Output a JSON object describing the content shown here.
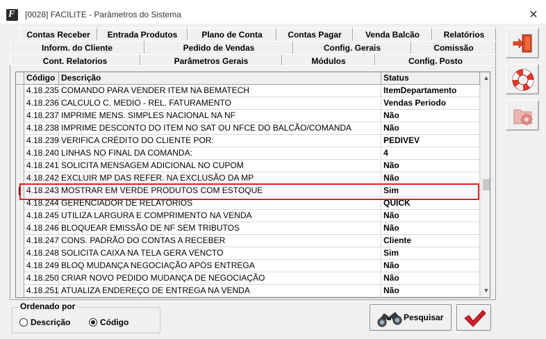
{
  "window": {
    "title": "[0028] FACILITE - Parâmetros do Sistema",
    "close": "✕"
  },
  "tabs": {
    "row1": [
      "Contas Receber",
      "Entrada Produtos",
      "Plano de Conta",
      "Contas Pagar",
      "Venda Balcão",
      "Relatórios"
    ],
    "row2": [
      "Inform. do Cliente",
      "Pedido de Vendas",
      "Config. Gerais",
      "Comissão"
    ],
    "row3": [
      "Cont. Relatorios",
      "Parâmetros Gerais",
      "Módulos",
      "Config. Posto"
    ],
    "active": "Parâmetros Gerais"
  },
  "grid": {
    "columns": [
      "Código",
      "Descrição",
      "Status"
    ],
    "rows": [
      {
        "code": "4.18.235",
        "desc": "COMANDO PARA VENDER ITEM NA BEMATECH",
        "status": "ItemDepartamento"
      },
      {
        "code": "4.18.236",
        "desc": "CALCULO C. MEDIO - REL. FATURAMENTO",
        "status": "Vendas Periodo"
      },
      {
        "code": "4.18.237",
        "desc": "IMPRIME MENS. SIMPLES NACIONAL NA NF",
        "status": "Não"
      },
      {
        "code": "4.18.238",
        "desc": "IMPRIME DESCONTO DO ITEM NO SAT OU NFCE DO BALCÃO/COMANDA",
        "status": "Não"
      },
      {
        "code": "4.18.239",
        "desc": "VERIFICA CRÉDITO DO CLIENTE POR:",
        "status": "PEDIVEV"
      },
      {
        "code": "4.18.240",
        "desc": "LINHAS NO FINAL DA COMANDA:",
        "status": "4"
      },
      {
        "code": "4.18.241",
        "desc": "SOLICITA MENSAGEM ADICIONAL NO CUPOM",
        "status": "Não"
      },
      {
        "code": "4.18.242",
        "desc": "EXCLUIR MP DAS REFER. NA EXCLUSÃO DA MP",
        "status": "Não"
      },
      {
        "code": "4.18.243",
        "desc": "MOSTRAR EM VERDE PRODUTOS COM ESTOQUE",
        "status": "Sim"
      },
      {
        "code": "4.18.244",
        "desc": "GERENCIADOR DE RELATÓRIOS",
        "status": "QUICK"
      },
      {
        "code": "4.18.245",
        "desc": "UTILIZA LARGURA E COMPRIMENTO NA VENDA",
        "status": "Não"
      },
      {
        "code": "4.18.246",
        "desc": "BLOQUEAR EMISSÃO DE NF SEM TRIBUTOS",
        "status": "Não"
      },
      {
        "code": "4.18.247",
        "desc": "CONS. PADRÃO DO CONTAS A RECEBER",
        "status": "Cliente"
      },
      {
        "code": "4.18.248",
        "desc": "SOLICITA CAIXA NA TELA GERA VENCTO",
        "status": "Sim"
      },
      {
        "code": "4.18.249",
        "desc": "BLOQ MUDANÇA NEGOCIAÇÃO APÓS ENTREGA",
        "status": "Não"
      },
      {
        "code": "4.18.250",
        "desc": "CRIAR NOVO PEDIDO MUDANÇA DE NEGOCIAÇÃO",
        "status": "Não"
      },
      {
        "code": "4.18.251",
        "desc": "ATUALIZA ENDEREÇO DE ENTREGA NA VENDA",
        "status": "Não"
      }
    ],
    "selected_row": "4.18.243"
  },
  "order": {
    "legend": "Ordenado por",
    "options": [
      "Descrição",
      "Código"
    ],
    "selected": "Código"
  },
  "buttons": {
    "search": "Pesquisar"
  },
  "icons": {
    "exit": "exit-door-icon",
    "help": "lifebuoy-icon",
    "settings": "gear-folder-icon",
    "search": "binoculars-icon",
    "confirm": "checkmark-icon"
  },
  "colors": {
    "highlight_border": "#e02020",
    "confirm_check": "#d0202a"
  }
}
